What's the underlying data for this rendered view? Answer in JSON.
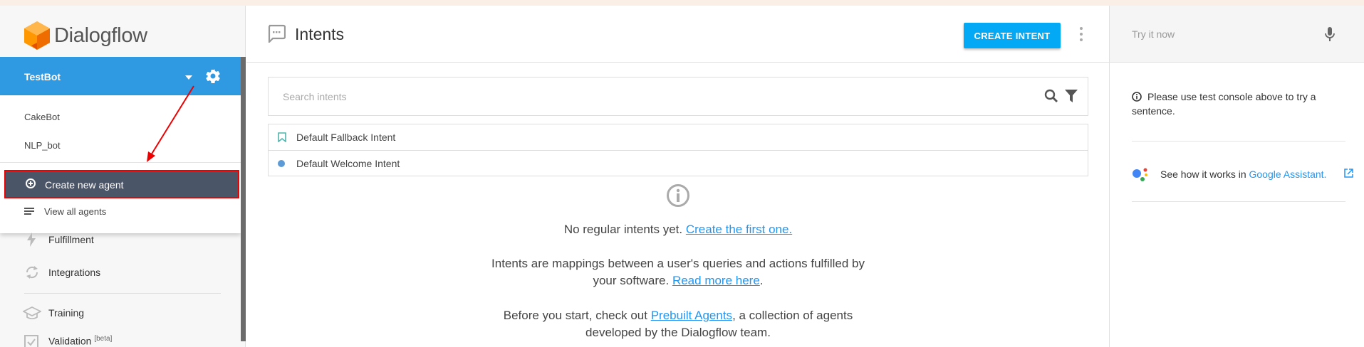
{
  "app": {
    "name": "Dialogflow"
  },
  "agent_selector": {
    "current": "TestBot",
    "agents": [
      "CakeBot",
      "NLP_bot"
    ],
    "create_label": "Create new agent",
    "view_all_label": "View all agents"
  },
  "nav": {
    "fulfillment": "Fulfillment",
    "integrations": "Integrations",
    "training": "Training",
    "validation": "Validation",
    "validation_badge": "[beta]"
  },
  "main": {
    "title": "Intents",
    "create_button": "CREATE INTENT",
    "search_placeholder": "Search intents",
    "intents": [
      "Default Fallback Intent",
      "Default Welcome Intent"
    ],
    "empty": {
      "line1": "No regular intents yet.",
      "line1_link": "Create the first one.",
      "para2_a": "Intents are mappings between a user's queries and actions fulfilled by",
      "para2_b": "your software.",
      "para2_link": "Read more here",
      "para2_end": ".",
      "para3_a": "Before you start, check out",
      "para3_link": "Prebuilt Agents",
      "para3_b": ", a collection of agents",
      "para3_c": "developed by the Dialogflow team."
    }
  },
  "test_panel": {
    "placeholder": "Try it now",
    "info": "Please use test console above to try a sentence.",
    "ga_text": "See how it works in",
    "ga_link": "Google Assistant."
  },
  "colors": {
    "accent": "#2f9ae2",
    "primary_button": "#03a9f4",
    "link": "#2196f3",
    "highlight_border": "#e00000",
    "selected_item": "#4b5568"
  }
}
